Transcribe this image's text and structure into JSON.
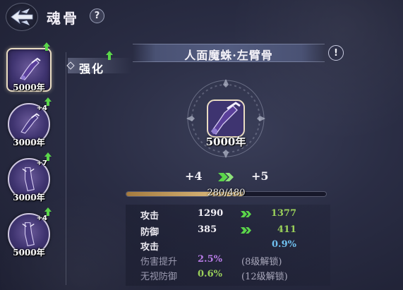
{
  "header": {
    "title": "魂骨",
    "help_label": "?"
  },
  "tab": {
    "label": "强化"
  },
  "bones": [
    {
      "year": "5000年",
      "plus": "",
      "upgradeable": true,
      "selected": true
    },
    {
      "year": "3000年",
      "plus": "+4",
      "upgradeable": true,
      "selected": false
    },
    {
      "year": "3000年",
      "plus": "+7",
      "upgradeable": true,
      "selected": false
    },
    {
      "year": "5000年",
      "plus": "+4",
      "upgradeable": true,
      "selected": false
    }
  ],
  "detail": {
    "name": "人面魔蛛·左臂骨",
    "info_label": "!",
    "year": "5000年",
    "level_from": "+4",
    "level_to": "+5",
    "progress_text": "280/480",
    "progress_fraction": 0.5833
  },
  "stats": [
    {
      "name": "攻击",
      "current": "1290",
      "next": "1377",
      "next_color": "#9ad05a"
    },
    {
      "name": "防御",
      "current": "385",
      "next": "411",
      "next_color": "#9ad05a"
    },
    {
      "name": "攻击",
      "current": "",
      "next": "0.9%",
      "next_color": "#6fc0ef"
    }
  ],
  "locked_stats": [
    {
      "name": "伤害提升",
      "value": "2.5%",
      "value_color": "#b77be6",
      "unlock": "(8级解锁)"
    },
    {
      "name": "无视防御",
      "value": "0.6%",
      "value_color": "#9ad05a",
      "unlock": "(12级解锁)"
    }
  ],
  "colors": {
    "arrow_green": "#5bd64a",
    "progress_gold": "#e9c98a",
    "bone_purple": "#3f3470"
  },
  "icons": {
    "back": "winged-back-icon",
    "upgrade": "green-up-arrow-icon",
    "bone": "soul-bone-arm-icon",
    "level_arrow": "double-chevron-right-icon"
  }
}
